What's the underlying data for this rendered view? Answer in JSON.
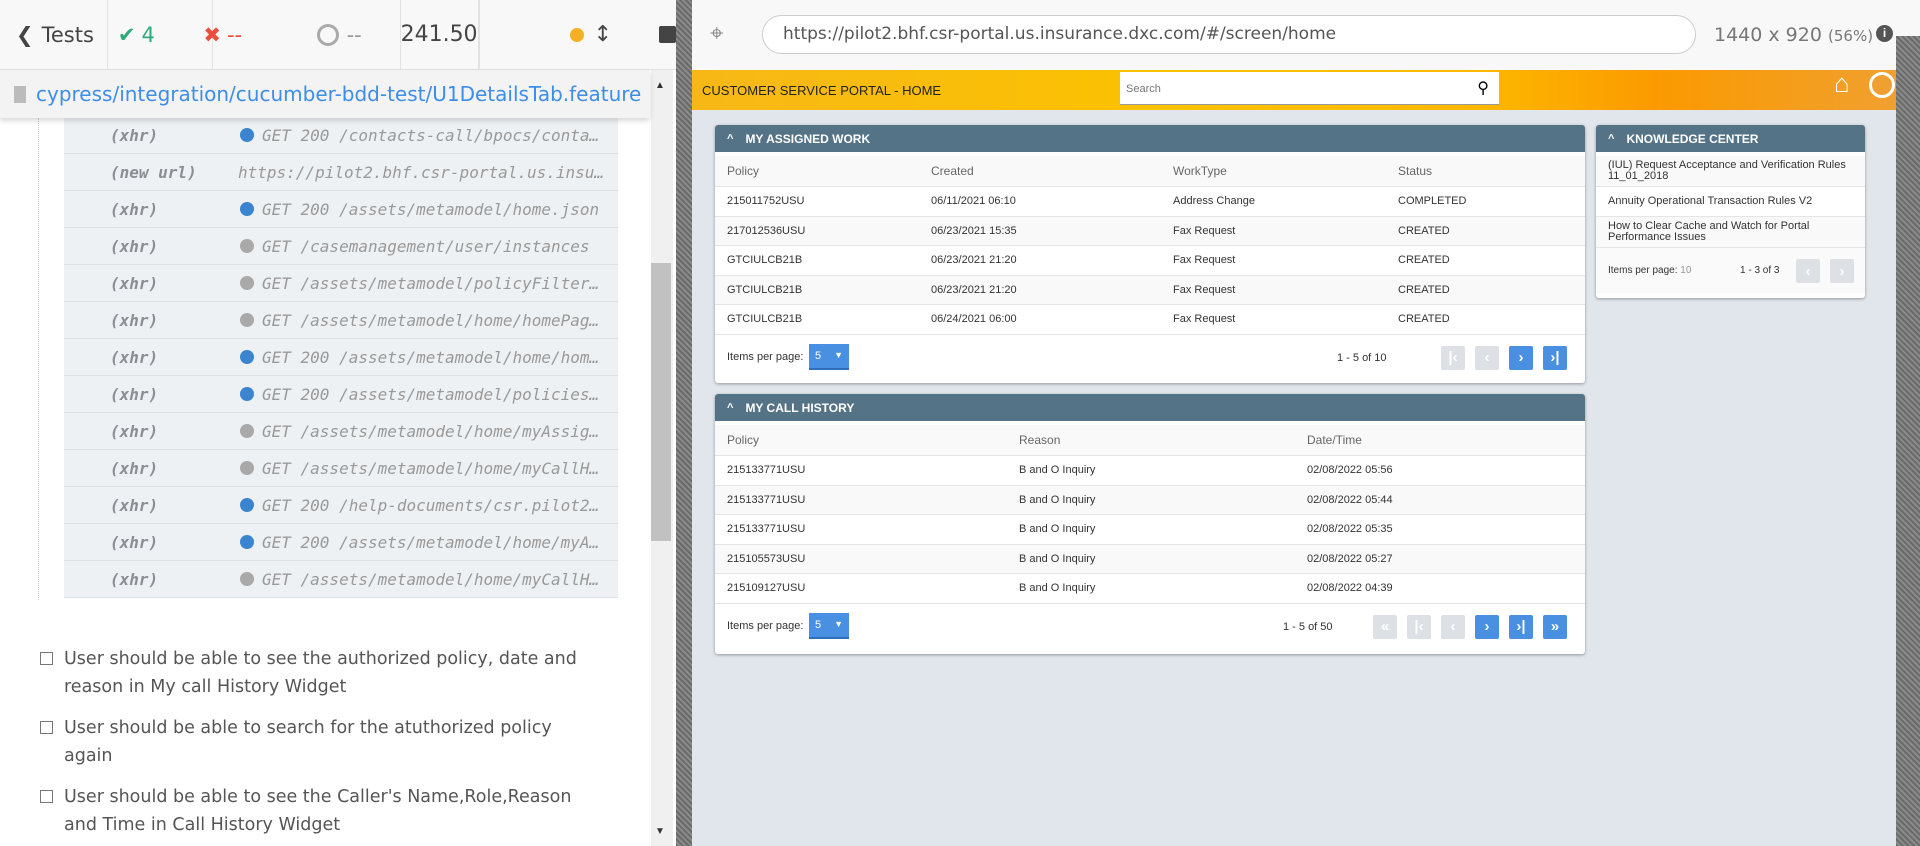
{
  "runner": {
    "back_label": "Tests",
    "passed": "4",
    "failed": "--",
    "pending": "--",
    "duration": "241.50",
    "colors": {
      "pass": "#2eaa7c",
      "fail": "#e94f3c",
      "running": "#f6b024",
      "link": "#3e8de8"
    },
    "file_path": "cypress/integration/cucumber-bdd-test/U1DetailsTab.feature",
    "log": [
      {
        "kind": "(xhr)",
        "dot": "blue",
        "text": "GET 200 /contacts-call/bpocs/conta…"
      },
      {
        "kind": "(new url)",
        "dot": "none",
        "text": "https://pilot2.bhf.csr-portal.us.insu…"
      },
      {
        "kind": "(xhr)",
        "dot": "blue",
        "text": "GET 200 /assets/metamodel/home.json"
      },
      {
        "kind": "(xhr)",
        "dot": "gray",
        "text": "GET /casemanagement/user/instances"
      },
      {
        "kind": "(xhr)",
        "dot": "gray",
        "text": "GET /assets/metamodel/policyFilter…"
      },
      {
        "kind": "(xhr)",
        "dot": "gray",
        "text": "GET /assets/metamodel/home/homePag…"
      },
      {
        "kind": "(xhr)",
        "dot": "blue",
        "text": "GET 200 /assets/metamodel/home/hom…"
      },
      {
        "kind": "(xhr)",
        "dot": "blue",
        "text": "GET 200 /assets/metamodel/policies…"
      },
      {
        "kind": "(xhr)",
        "dot": "gray",
        "text": "GET /assets/metamodel/home/myAssig…"
      },
      {
        "kind": "(xhr)",
        "dot": "gray",
        "text": "GET /assets/metamodel/home/myCallH…"
      },
      {
        "kind": "(xhr)",
        "dot": "blue",
        "text": "GET 200 /help-documents/csr.pilot2…"
      },
      {
        "kind": "(xhr)",
        "dot": "blue",
        "text": "GET 200 /assets/metamodel/home/myA…"
      },
      {
        "kind": "(xhr)",
        "dot": "gray",
        "text": "GET /assets/metamodel/home/myCallH…"
      }
    ],
    "steps": [
      "User should be able to see the authorized policy, date and reason in My call History Widget",
      "User should be able to search for the atuthorized policy again",
      "User should be able to see the Caller's Name,Role,Reason and Time in Call History Widget"
    ]
  },
  "browser": {
    "url": "https://pilot2.bhf.csr-portal.us.insurance.dxc.com/#/screen/home",
    "viewport": "1440 x 920",
    "scale": "(56%)"
  },
  "portal": {
    "title": "CUSTOMER SERVICE PORTAL - HOME",
    "search_placeholder": "Search",
    "assigned": {
      "title": "MY ASSIGNED WORK",
      "columns": [
        "Policy",
        "Created",
        "WorkType",
        "Status"
      ],
      "rows": [
        [
          "215011752USU",
          "06/11/2021 06:10",
          "Address Change",
          "COMPLETED"
        ],
        [
          "217012536USU",
          "06/23/2021 15:35",
          "Fax Request",
          "CREATED"
        ],
        [
          "GTCIULCB21B",
          "06/23/2021 21:20",
          "Fax Request",
          "CREATED"
        ],
        [
          "GTCIULCB21B",
          "06/23/2021 21:20",
          "Fax Request",
          "CREATED"
        ],
        [
          "GTCIULCB21B",
          "06/24/2021 06:00",
          "Fax Request",
          "CREATED"
        ]
      ],
      "items_label": "Items per page:",
      "items_value": "5",
      "range": "1 - 5 of 10"
    },
    "calls": {
      "title": "MY CALL HISTORY",
      "columns": [
        "Policy",
        "Reason",
        "Date/Time"
      ],
      "rows": [
        [
          "215133771USU",
          "B and O Inquiry",
          "02/08/2022 05:56"
        ],
        [
          "215133771USU",
          "B and O Inquiry",
          "02/08/2022 05:44"
        ],
        [
          "215133771USU",
          "B and O Inquiry",
          "02/08/2022 05:35"
        ],
        [
          "215105573USU",
          "B and O Inquiry",
          "02/08/2022 05:27"
        ],
        [
          "215109127USU",
          "B and O Inquiry",
          "02/08/2022 04:39"
        ]
      ],
      "items_label": "Items per page:",
      "items_value": "5",
      "range": "1 - 5 of 50"
    },
    "knowledge": {
      "title": "KNOWLEDGE CENTER",
      "items": [
        "(IUL) Request Acceptance and Verification Rules 11_01_2018",
        "Annuity Operational Transaction Rules V2",
        "How to Clear Cache and Watch for Portal Performance Issues"
      ],
      "items_label": "Items per page:",
      "items_value": "10",
      "range": "1 - 3 of 3"
    }
  }
}
